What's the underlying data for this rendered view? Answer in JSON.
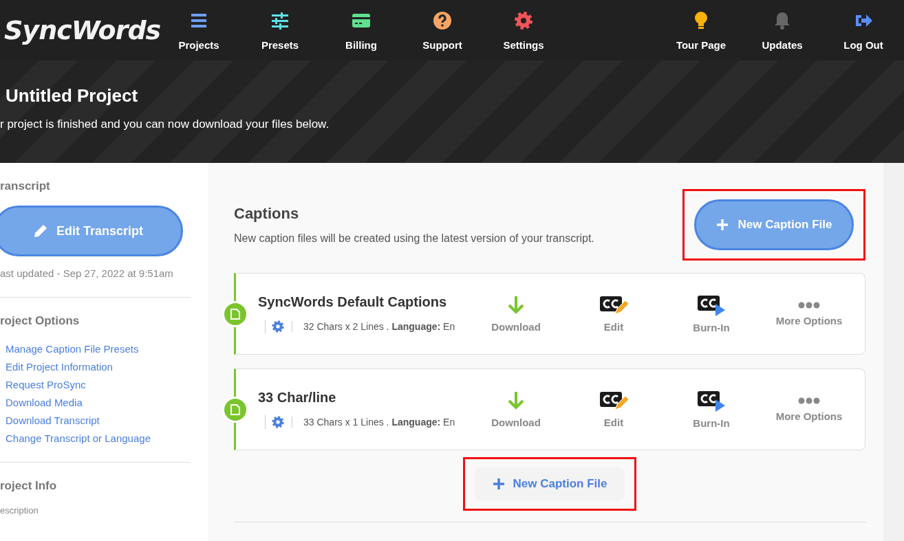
{
  "header": {
    "logo": "SyncWords",
    "nav": [
      {
        "label": "Projects"
      },
      {
        "label": "Presets"
      },
      {
        "label": "Billing"
      },
      {
        "label": "Support"
      },
      {
        "label": "Settings"
      }
    ],
    "nav_right": [
      {
        "label": "Tour Page"
      },
      {
        "label": "Updates"
      },
      {
        "label": "Log Out"
      }
    ]
  },
  "hero": {
    "title": "Untitled Project",
    "subtitle": "r project is finished and you can now download your files below."
  },
  "sidebar": {
    "transcript_heading": "ranscript",
    "edit_button": "Edit Transcript",
    "last_updated": "ast updated - Sep 27, 2022 at 9:51am",
    "options_heading": "roject Options",
    "options": [
      "Manage Caption File Presets",
      "Edit Project Information",
      "Request ProSync",
      "Download Media",
      "Download Transcript",
      "Change Transcript or Language"
    ],
    "info_heading": "roject Info",
    "info_label": "escription"
  },
  "captions": {
    "title": "Captions",
    "description": "New caption files will be created using the latest version of your transcript.",
    "new_button": {
      "label": "New Caption File",
      "highlighted": true
    },
    "files": [
      {
        "name": "SyncWords Default Captions",
        "details": "32 Chars x 2 Lines . **Language:** En",
        "actions": [
          {
            "kind": "download",
            "label": "Download"
          },
          {
            "kind": "edit",
            "label": "Edit"
          },
          {
            "kind": "burnin",
            "label": "Burn-In"
          },
          {
            "kind": "more",
            "label": "More Options"
          }
        ]
      },
      {
        "name": "33 Char/line",
        "details": "33 Chars x 1 Lines . **Language:** En",
        "actions": [
          {
            "kind": "download",
            "label": "Download"
          },
          {
            "kind": "edit",
            "label": "Edit"
          },
          {
            "kind": "burnin",
            "label": "Burn-In"
          },
          {
            "kind": "more",
            "label": "More Options"
          }
        ]
      }
    ],
    "bottom_button": {
      "label": "New Caption File",
      "highlighted": true
    }
  }
}
